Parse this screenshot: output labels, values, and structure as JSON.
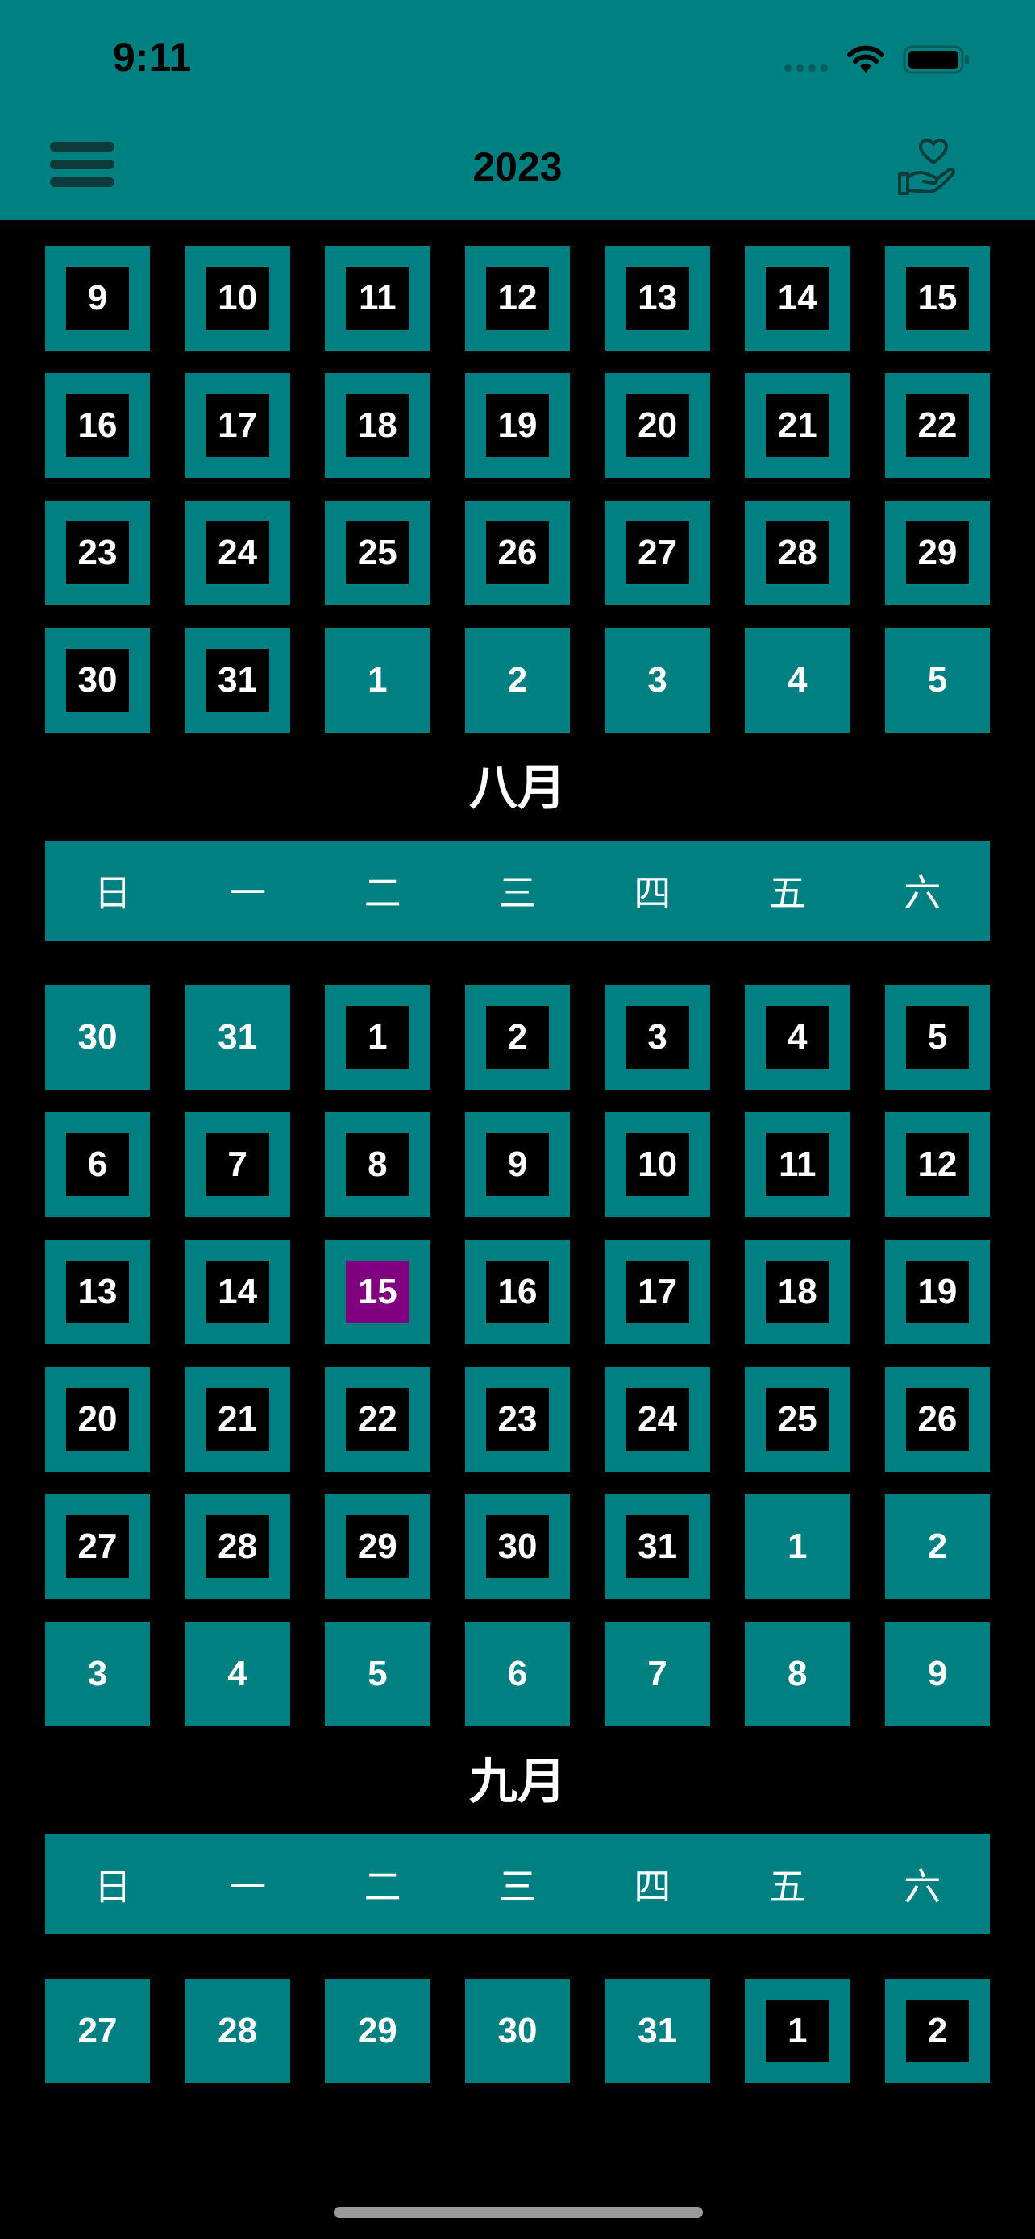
{
  "status_bar": {
    "time": "9:11"
  },
  "header": {
    "title": "2023"
  },
  "weekdays": [
    "日",
    "一",
    "二",
    "三",
    "四",
    "五",
    "六"
  ],
  "july_partial": {
    "rows": [
      [
        {
          "d": "9",
          "in": true
        },
        {
          "d": "10",
          "in": true
        },
        {
          "d": "11",
          "in": true
        },
        {
          "d": "12",
          "in": true
        },
        {
          "d": "13",
          "in": true
        },
        {
          "d": "14",
          "in": true
        },
        {
          "d": "15",
          "in": true
        }
      ],
      [
        {
          "d": "16",
          "in": true
        },
        {
          "d": "17",
          "in": true
        },
        {
          "d": "18",
          "in": true
        },
        {
          "d": "19",
          "in": true
        },
        {
          "d": "20",
          "in": true
        },
        {
          "d": "21",
          "in": true
        },
        {
          "d": "22",
          "in": true
        }
      ],
      [
        {
          "d": "23",
          "in": true
        },
        {
          "d": "24",
          "in": true
        },
        {
          "d": "25",
          "in": true
        },
        {
          "d": "26",
          "in": true
        },
        {
          "d": "27",
          "in": true
        },
        {
          "d": "28",
          "in": true
        },
        {
          "d": "29",
          "in": true
        }
      ],
      [
        {
          "d": "30",
          "in": true
        },
        {
          "d": "31",
          "in": true
        },
        {
          "d": "1",
          "in": false
        },
        {
          "d": "2",
          "in": false
        },
        {
          "d": "3",
          "in": false
        },
        {
          "d": "4",
          "in": false
        },
        {
          "d": "5",
          "in": false
        }
      ]
    ]
  },
  "august": {
    "title": "八月",
    "rows": [
      [
        {
          "d": "30",
          "in": false
        },
        {
          "d": "31",
          "in": false
        },
        {
          "d": "1",
          "in": true
        },
        {
          "d": "2",
          "in": true
        },
        {
          "d": "3",
          "in": true
        },
        {
          "d": "4",
          "in": true
        },
        {
          "d": "5",
          "in": true
        }
      ],
      [
        {
          "d": "6",
          "in": true
        },
        {
          "d": "7",
          "in": true
        },
        {
          "d": "8",
          "in": true
        },
        {
          "d": "9",
          "in": true
        },
        {
          "d": "10",
          "in": true
        },
        {
          "d": "11",
          "in": true
        },
        {
          "d": "12",
          "in": true
        }
      ],
      [
        {
          "d": "13",
          "in": true
        },
        {
          "d": "14",
          "in": true
        },
        {
          "d": "15",
          "in": true,
          "today": true
        },
        {
          "d": "16",
          "in": true
        },
        {
          "d": "17",
          "in": true
        },
        {
          "d": "18",
          "in": true
        },
        {
          "d": "19",
          "in": true
        }
      ],
      [
        {
          "d": "20",
          "in": true
        },
        {
          "d": "21",
          "in": true
        },
        {
          "d": "22",
          "in": true
        },
        {
          "d": "23",
          "in": true
        },
        {
          "d": "24",
          "in": true
        },
        {
          "d": "25",
          "in": true
        },
        {
          "d": "26",
          "in": true
        }
      ],
      [
        {
          "d": "27",
          "in": true
        },
        {
          "d": "28",
          "in": true
        },
        {
          "d": "29",
          "in": true
        },
        {
          "d": "30",
          "in": true
        },
        {
          "d": "31",
          "in": true
        },
        {
          "d": "1",
          "in": false
        },
        {
          "d": "2",
          "in": false
        }
      ],
      [
        {
          "d": "3",
          "in": false
        },
        {
          "d": "4",
          "in": false
        },
        {
          "d": "5",
          "in": false
        },
        {
          "d": "6",
          "in": false
        },
        {
          "d": "7",
          "in": false
        },
        {
          "d": "8",
          "in": false
        },
        {
          "d": "9",
          "in": false
        }
      ]
    ]
  },
  "september": {
    "title": "九月",
    "rows": [
      [
        {
          "d": "27",
          "in": false
        },
        {
          "d": "28",
          "in": false
        },
        {
          "d": "29",
          "in": false
        },
        {
          "d": "30",
          "in": false
        },
        {
          "d": "31",
          "in": false
        },
        {
          "d": "1",
          "in": true
        },
        {
          "d": "2",
          "in": true
        }
      ]
    ]
  },
  "colors": {
    "accent": "#008080",
    "background": "#000000",
    "today": "#800080",
    "text": "#ffffff"
  }
}
